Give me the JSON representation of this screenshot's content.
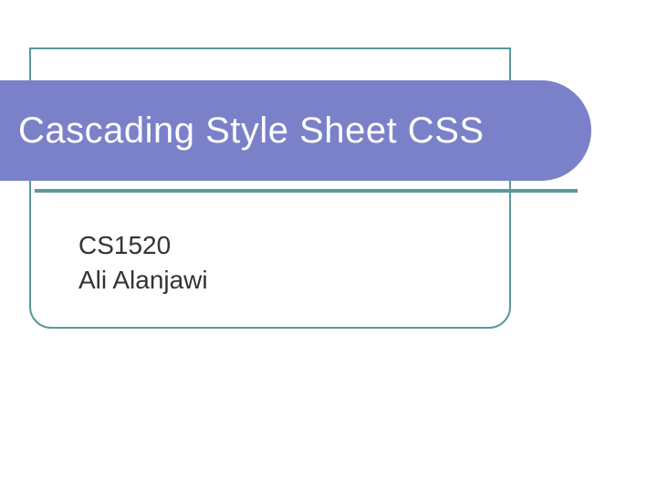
{
  "slide": {
    "title": "Cascading Style Sheet CSS",
    "course_code": "CS1520",
    "author": "Ali Alanjawi"
  }
}
